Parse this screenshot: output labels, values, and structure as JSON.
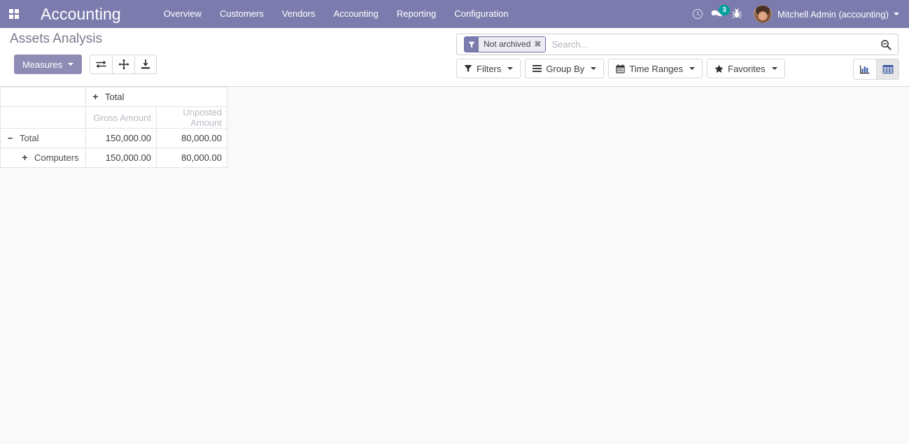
{
  "navbar": {
    "apps_icon": "apps-grid-icon",
    "brand": "Accounting",
    "menu": [
      {
        "label": "Overview"
      },
      {
        "label": "Customers"
      },
      {
        "label": "Vendors"
      },
      {
        "label": "Accounting"
      },
      {
        "label": "Reporting"
      },
      {
        "label": "Configuration"
      }
    ],
    "activities_icon": "clock-icon",
    "messaging_icon": "chat-bubble-icon",
    "messaging_badge": "3",
    "debug_icon": "bug-icon",
    "avatar_icon": "user-avatar",
    "user_name": "Mitchell Admin (accounting)",
    "accent_purple": "#7c7bad",
    "badge_color": "#00a09d"
  },
  "control_panel": {
    "breadcrumb": "Assets Analysis",
    "measures_label": "Measures",
    "flip_axis_icon": "flip-axis-icon",
    "expand_all_icon": "expand-all-icon",
    "download_icon": "download-xlsx-icon",
    "search": {
      "facet_icon": "filter-funnel-icon",
      "facet_label": "Not archived",
      "facet_remove_icon": "remove-facet-icon",
      "placeholder": "Search...",
      "value": "",
      "magnifier_icon": "search-icon"
    },
    "dropdowns": [
      {
        "label": "Filters",
        "icon": "filter-funnel-icon"
      },
      {
        "label": "Group By",
        "icon": "bars-icon"
      },
      {
        "label": "Time Ranges",
        "icon": "calendar-icon"
      },
      {
        "label": "Favorites",
        "icon": "star-icon"
      }
    ],
    "views": [
      {
        "name": "graph",
        "icon": "bar-chart-icon",
        "active": false
      },
      {
        "name": "pivot",
        "icon": "pivot-table-icon",
        "active": true
      }
    ]
  },
  "pivot": {
    "col_group_header": "Total",
    "col_group_toggle": "+",
    "measures": [
      "Gross Amount",
      "Unposted Amount"
    ],
    "rows": [
      {
        "toggle": "−",
        "label": "Total",
        "indent": false,
        "values": [
          "150,000.00",
          "80,000.00"
        ]
      },
      {
        "toggle": "+",
        "label": "Computers",
        "indent": true,
        "values": [
          "150,000.00",
          "80,000.00"
        ]
      }
    ]
  }
}
